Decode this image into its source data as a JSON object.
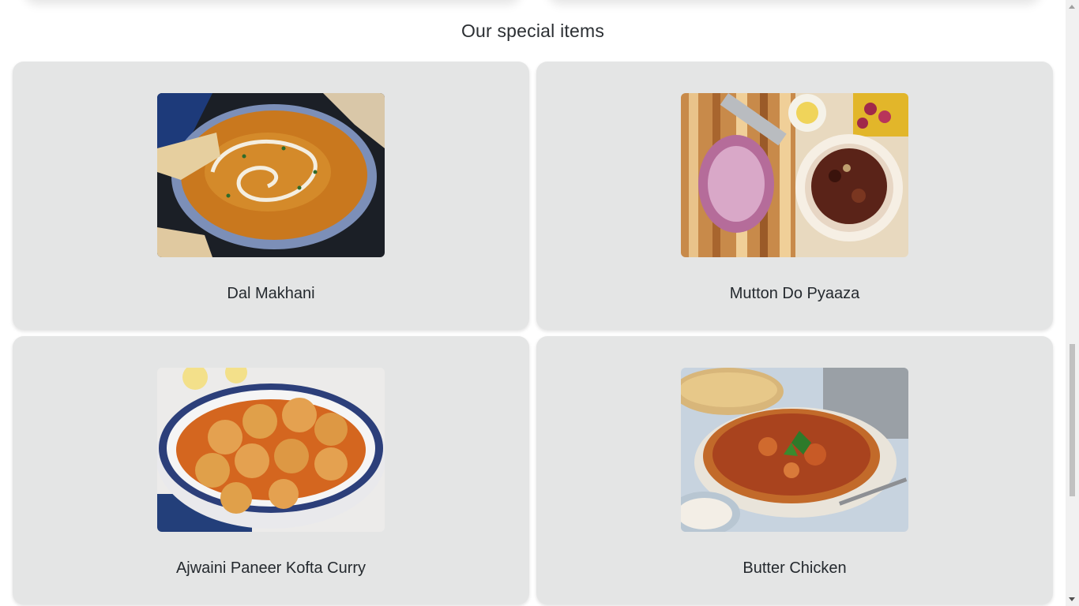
{
  "section": {
    "title": "Our special items"
  },
  "items": [
    {
      "name": "Dal Makhani",
      "image_icon": "dal-makhani-photo"
    },
    {
      "name": "Mutton Do Pyaaza",
      "image_icon": "mutton-do-pyaaza-photo"
    },
    {
      "name": "Ajwaini Paneer Kofta Curry",
      "image_icon": "paneer-kofta-photo"
    },
    {
      "name": "Butter Chicken",
      "image_icon": "butter-chicken-photo"
    }
  ],
  "colors": {
    "card_background": "#e4e5e5",
    "title_text": "#2b2f33",
    "card_text": "#24292e"
  }
}
